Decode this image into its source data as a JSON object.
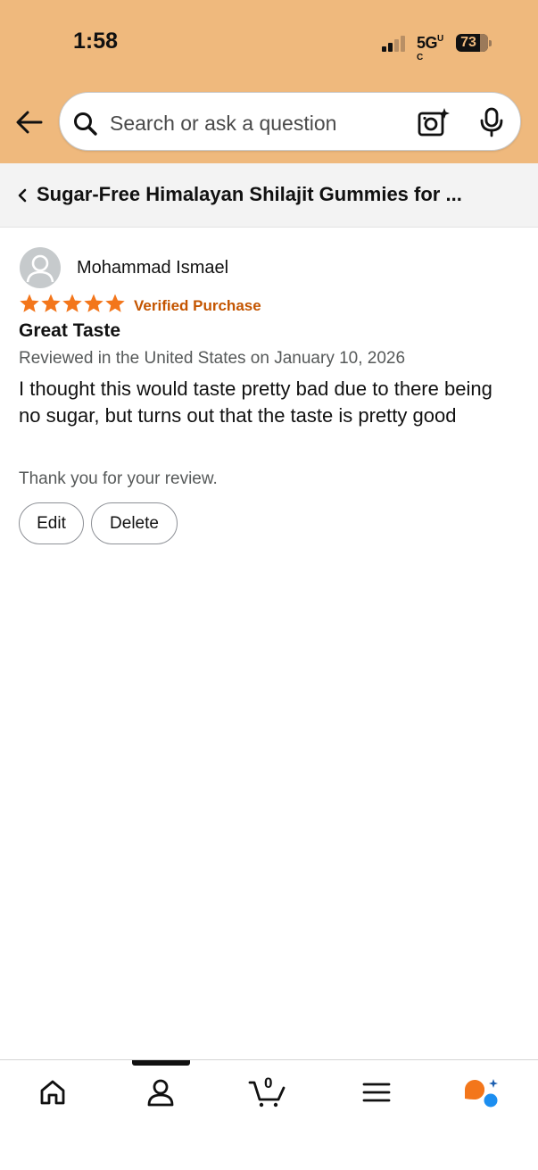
{
  "status_bar": {
    "time": "1:58",
    "network": "5G",
    "battery": "73"
  },
  "search": {
    "placeholder": "Search or ask a question"
  },
  "product": {
    "title": "Sugar-Free Himalayan Shilajit Gummies for ..."
  },
  "review": {
    "reviewer_name": "Mohammad Ismael",
    "rating": 5,
    "rating_max": 5,
    "verified_label": "Verified Purchase",
    "title": "Great Taste",
    "date_line": "Reviewed in the United States on January 10, 2026",
    "body": "I thought this would taste pretty bad due to there being no sugar, but turns out that the taste is pretty good",
    "thanks_message": "Thank you for your review.",
    "edit_label": "Edit",
    "delete_label": "Delete"
  },
  "bottom_nav": {
    "items": [
      "home-icon",
      "account-icon",
      "cart-icon",
      "menu-icon",
      "rufus-icon"
    ],
    "cart_count": "0"
  },
  "colors": {
    "header_bg": "#efb97d",
    "star": "#f3761b",
    "verified": "#c45500",
    "rufus_orange": "#f3761b",
    "rufus_blue": "#1c8ef0"
  }
}
